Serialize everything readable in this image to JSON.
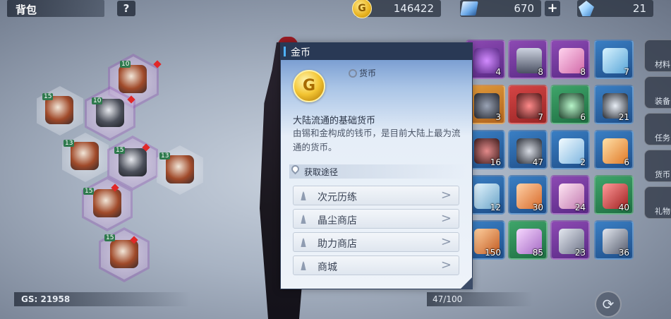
{
  "topbar": {
    "title": "背包",
    "help": "?",
    "gold": "146422",
    "gems": "670",
    "plus": "+",
    "crystals": "21"
  },
  "equip": {
    "gs": "GS: 21958",
    "levels": [
      "10",
      "15",
      "10",
      "13",
      "15",
      "13",
      "15",
      "15"
    ]
  },
  "capacity": "47/100",
  "grid_counts": [
    "4",
    "8",
    "8",
    "7",
    "3",
    "7",
    "6",
    "21",
    "16",
    "47",
    "2",
    "6",
    "12",
    "30",
    "24",
    "40",
    "150",
    "85",
    "23",
    "36"
  ],
  "sidetabs": [
    "材料",
    "装备",
    "任务",
    "货币",
    "礼物"
  ],
  "popup": {
    "title": "金币",
    "coin_letter": "G",
    "category": "货币",
    "desc_title": "大陆流通的基础货币",
    "desc_text": "由锡和金构成的钱币，是目前大陆上最为流通的货币。",
    "source_header": "获取途径",
    "sources": [
      "次元历练",
      "晶尘商店",
      "助力商店",
      "商城"
    ]
  },
  "colors": {
    "popup_header": "#293955",
    "gold": "#f3c533"
  }
}
